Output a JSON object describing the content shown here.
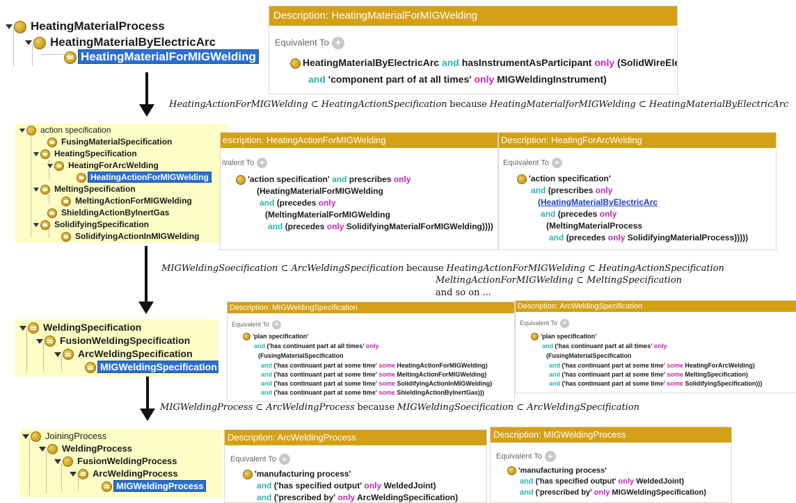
{
  "tree1": {
    "items": [
      "HeatingMaterialProcess",
      "HeatingMaterialByElectricArc",
      "HeatingMaterialForMIGWelding"
    ]
  },
  "panel1": {
    "title": "Description: HeatingMaterialForMIGWelding",
    "equivalent_to": "Equivalent To",
    "line1": {
      "a": "HeatingMaterialByElectricArc",
      "b": "and",
      "c": "hasInstrumentAsParticipant",
      "d": "only",
      "e": "(SolidWireElectrode a"
    },
    "line2": {
      "a": "and",
      "b": "'component part of at all times'",
      "c": "only",
      "d": "MIGWeldingInstrument)"
    }
  },
  "caption1": {
    "a": "HeatingActionForMIGWelding ⊂ HeatingActionSpecification",
    "because": "because",
    "b": "HeatingMaterialforMIGWelding ⊂ HeatingMaterialByElectricArc"
  },
  "tree2": {
    "items": [
      "action specification",
      "FusingMaterialSpecification",
      "HeatingSpecification",
      "HeatingForArcWelding",
      "HeatingActionForMIGWelding",
      "MeltingSpecification",
      "MeltingActionForMIGWelding",
      "ShieldingActionByInertGas",
      "SolidifyingSpecification",
      "SolidifyingActionInMIGWelding"
    ]
  },
  "panel2": {
    "title": "escription: HeatingActionForMIGWelding",
    "equivalent_to": "ivalent To",
    "l1": {
      "a": "'action specification'",
      "b": "and",
      "c": "prescribes",
      "d": "only"
    },
    "l2": "(HeatingMaterialForMIGWelding",
    "l3": {
      "a": "and",
      "b": "(precedes",
      "c": "only"
    },
    "l4": "(MeltingMaterialForMIGWelding",
    "l5": {
      "a": "and",
      "b": "(precedes",
      "c": "only",
      "d": "SolidifyingMaterialForMIGWelding))))"
    }
  },
  "panel3": {
    "title": "Description: HeatingForArcWelding",
    "equivalent_to": "Equivalent To",
    "l1": "'action specification'",
    "l2": {
      "a": "and",
      "b": "(prescribes",
      "c": "only"
    },
    "l3": "(HeatingMaterialByElectricArc",
    "l4": {
      "a": "and",
      "b": "(precedes",
      "c": "only"
    },
    "l5": "(MeltingMaterialProcess",
    "l6": {
      "a": "and",
      "b": "(precedes",
      "c": "only",
      "d": "SolidifyingMaterialProcess)))))"
    }
  },
  "caption2": {
    "a": "MIGWeldingSoecification ⊂ ArcWeldingSpecification",
    "because": "because",
    "b": "HeatingActionForMIGWelding ⊂ HeatingActionSpecification",
    "c": "MeltingActionForMIGWelding ⊂ MeltingSpecification",
    "d": "and so on ..."
  },
  "tree3": {
    "items": [
      "WeldingSpecification",
      "FusionWeldingSpecification",
      "ArcWeldingSpecification",
      "MIGWeldingSpecification"
    ]
  },
  "panel4": {
    "title": "Description: MIGWeldingSpecification",
    "equivalent_to": "Equivalent To",
    "l1": "'plan specification'",
    "l2": {
      "a": "and",
      "b": "('has continuant part at all times'",
      "c": "only"
    },
    "l3": "(FusingMaterialSpecification",
    "l4": {
      "a": "and",
      "b": "('has continuant part at some time'",
      "c": "some",
      "d": "HeatingActionForMIGWelding)"
    },
    "l5": {
      "a": "and",
      "b": "('has continuant part at some time'",
      "c": "some",
      "d": "MeltingActionForMIGWelding)"
    },
    "l6": {
      "a": "and",
      "b": "('has continuant part at some time'",
      "c": "some",
      "d": "SolidifyingActionInMIGWelding)"
    },
    "l7": {
      "a": "and",
      "b": "('has continuant part at some time'",
      "c": "some",
      "d": "ShieldingActionByInertGas)))"
    }
  },
  "panel5": {
    "title": "Description: ArcWeldingSpecification",
    "equivalent_to": "Equivalent To",
    "l1": "'plan specification'",
    "l2": {
      "a": "and",
      "b": "('has continuant part at all times'",
      "c": "only"
    },
    "l3": "(FusingMaterialSpecification",
    "l4": {
      "a": "and",
      "b": "('has continuant part at some time'",
      "c": "some",
      "d": "HeatingForArcWelding)"
    },
    "l5": {
      "a": "and",
      "b": "('has continuant part at some time'",
      "c": "some",
      "d": "MeltingSpecification)"
    },
    "l6": {
      "a": "and",
      "b": "('has continuant part at some time'",
      "c": "some",
      "d": "SolidifyingSpecification)))"
    }
  },
  "caption3": {
    "a": "MIGWeldingProcess ⊂ ArcWeldingProcess",
    "because": "because",
    "b": "MIGWeldingSoecification ⊂ ArcWeldingSpecification"
  },
  "tree4": {
    "items": [
      "JoiningProcess",
      "WeldingProcess",
      "FusionWeldingProcess",
      "ArcWeldingProcess",
      "MIGWeldingProcess"
    ]
  },
  "panel6": {
    "title": "Description: ArcWeldingProcess",
    "equivalent_to": "Equivalent To",
    "l1": "'manufacturing process'",
    "l2": {
      "a": "and",
      "b": "('has specified output'",
      "c": "only",
      "d": "WeldedJoint)"
    },
    "l3": {
      "a": "and",
      "b": "('prescribed by'",
      "c": "only",
      "d": "ArcWeldingSpecification)"
    }
  },
  "panel7": {
    "title": "Description: MIGWeldingProcess",
    "equivalent_to": "Equivalent To",
    "l1": "'manufacturing process'",
    "l2": {
      "a": "and",
      "b": "('has specified output'",
      "c": "only",
      "d": "WeldedJoint)"
    },
    "l3": {
      "a": "and",
      "b": "('prescribed by'",
      "c": "only",
      "d": "MIGWeldingSpecification)"
    }
  },
  "colors": {
    "title_bar": "#d4a017",
    "keyword_and": "#2bb3b3",
    "keyword_quant": "#c026b6",
    "selection": "#2a6fd1",
    "tree_bg": "#fdfdc6"
  }
}
